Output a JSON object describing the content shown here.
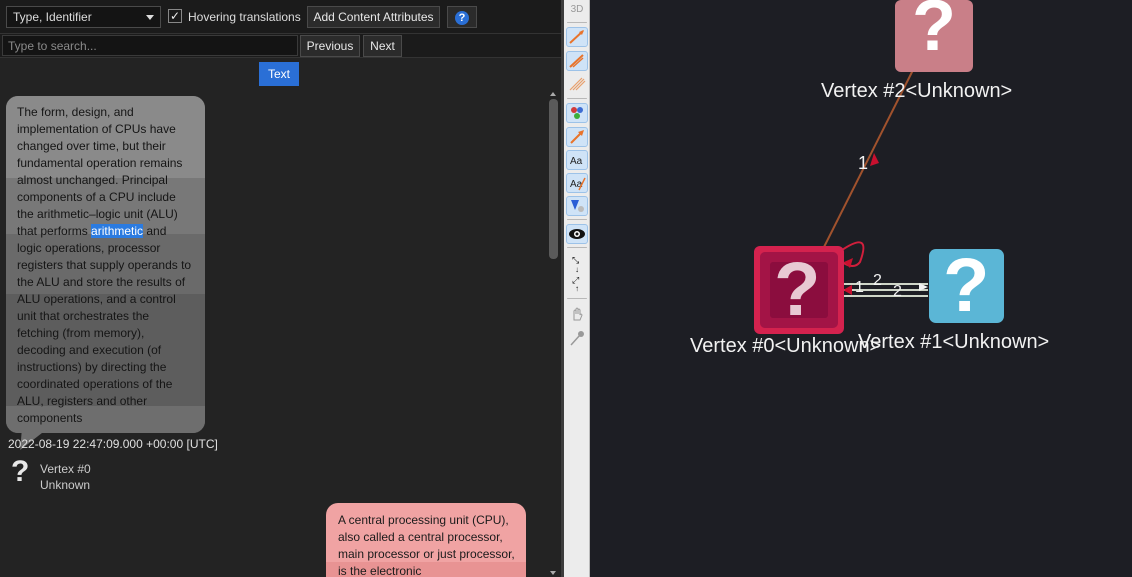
{
  "toolbar": {
    "select_value": "Type, Identifier",
    "hover_checkbox": "✓",
    "hover_label": "Hovering translations",
    "add_attributes": "Add Content Attributes",
    "help": "?"
  },
  "search": {
    "placeholder": "Type to search...",
    "previous": "Previous",
    "next": "Next"
  },
  "text_tab": "Text",
  "messages": [
    {
      "text_before": "The form, design, and\nimplementation of CPUs have\nchanged over time, but their\nfundamental operation remains\nalmost unchanged. Principal\ncomponents of a CPU include\nthe arithmetic–logic unit (ALU)\nthat performs ",
      "highlight": "arithmetic",
      "text_after": " and\nlogic operations, processor\nregisters that supply operands to\nthe ALU and store the results of\nALU operations, and a control\nunit that orchestrates the\nfetching (from memory),\ndecoding and execution (of\ninstructions) by directing the\ncoordinated operations of the\nALU, registers and other\ncomponents",
      "timestamp": "2022-08-19 22:47:09.000 +00:00 [UTC]",
      "sender_icon": "?",
      "sender_name": "Vertex #0",
      "sender_type": "Unknown"
    },
    {
      "text": "A central processing unit (CPU), also called a central processor, main processor or just processor, is the electronic"
    }
  ],
  "sidetool": {
    "top_label": "3D"
  },
  "graph": {
    "vertices": [
      {
        "label": "Vertex #2<Unknown>",
        "glyph": "?",
        "color": "#c97f88"
      },
      {
        "label": "Vertex #0<Unknown>",
        "glyph": "?",
        "color": "#b5154a"
      },
      {
        "label": "Vertex #1<Unknown>",
        "glyph": "?",
        "color": "#5bb6d6"
      }
    ],
    "edge_labels": {
      "e20": "1",
      "e01a": "1",
      "e01b": "2",
      "e01c": "2"
    },
    "colors": {
      "edge_brown": "#a0522d",
      "loop_red": "#d21f3c",
      "arrow_red": "#c8102e"
    }
  }
}
